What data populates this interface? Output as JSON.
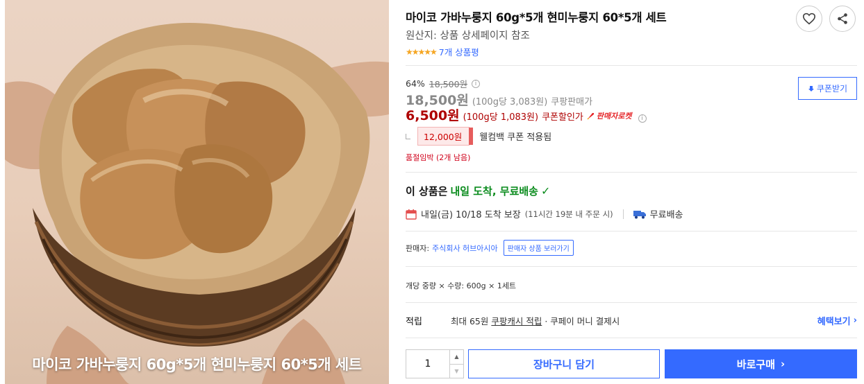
{
  "product": {
    "image_caption": "마이코 가바누룽지 60g*5개 현미누룽지 60*5개 세트",
    "title": "마이코 가바누룽지 60g*5개 현미누룽지 60*5개 세트",
    "origin": "원산지: 상품 상세페이지 참조",
    "stars": "★★★★★",
    "rating_value": 5,
    "review_link": "7개 상품평"
  },
  "actions": {
    "like_icon": "heart-icon",
    "share_icon": "share-icon"
  },
  "price": {
    "discount_rate": "64%",
    "original_price": "18,500원",
    "info_glyph": "i",
    "sale_price": "18,500원",
    "sale_unit": "(100g당 3,083원)",
    "sale_label": "쿠팡판매가",
    "coupon_price": "6,500원",
    "coupon_unit": "(100g당 1,083원)",
    "coupon_label": "쿠폰할인가",
    "rocket_badge": "판매자로켓",
    "welcome_coupon": "12,000원",
    "welcome_text": "웰컴백 쿠폰 적용됨",
    "stock_warning": "품절임박 (2개 남음)",
    "accent_red": "#ae0000"
  },
  "coupon_download": {
    "label": "쿠폰받기",
    "icon": "download-icon"
  },
  "delivery": {
    "prefix": "이 상품은",
    "highlight": "내일 도착, 무료배송",
    "check": "✓",
    "arrival": "내일(금) 10/18 도착 보장",
    "arrival_note": "(11시간 19분 내 주문 시)",
    "free_shipping": "무료배송",
    "accent_green": "#0b8c1e"
  },
  "seller": {
    "label": "판매자:",
    "name": "주식회사 허브아시아",
    "products_button": "판매자 상품 보러가기"
  },
  "option": {
    "spec": "개당 중량 × 수량: 600g × 1세트"
  },
  "reward": {
    "label": "적립",
    "text_before": "최대 65원 ",
    "cash": "쿠팡캐시 적립",
    "text_after": " · 쿠페이 머니 결제시",
    "benefit_link": "혜택보기",
    "chevron": "›"
  },
  "purchase": {
    "quantity": "1",
    "up": "▲",
    "down": "▼",
    "cart_button": "장바구니 담기",
    "buy_button": "바로구매",
    "buy_chevron": "›",
    "accent_blue": "#346aff"
  }
}
